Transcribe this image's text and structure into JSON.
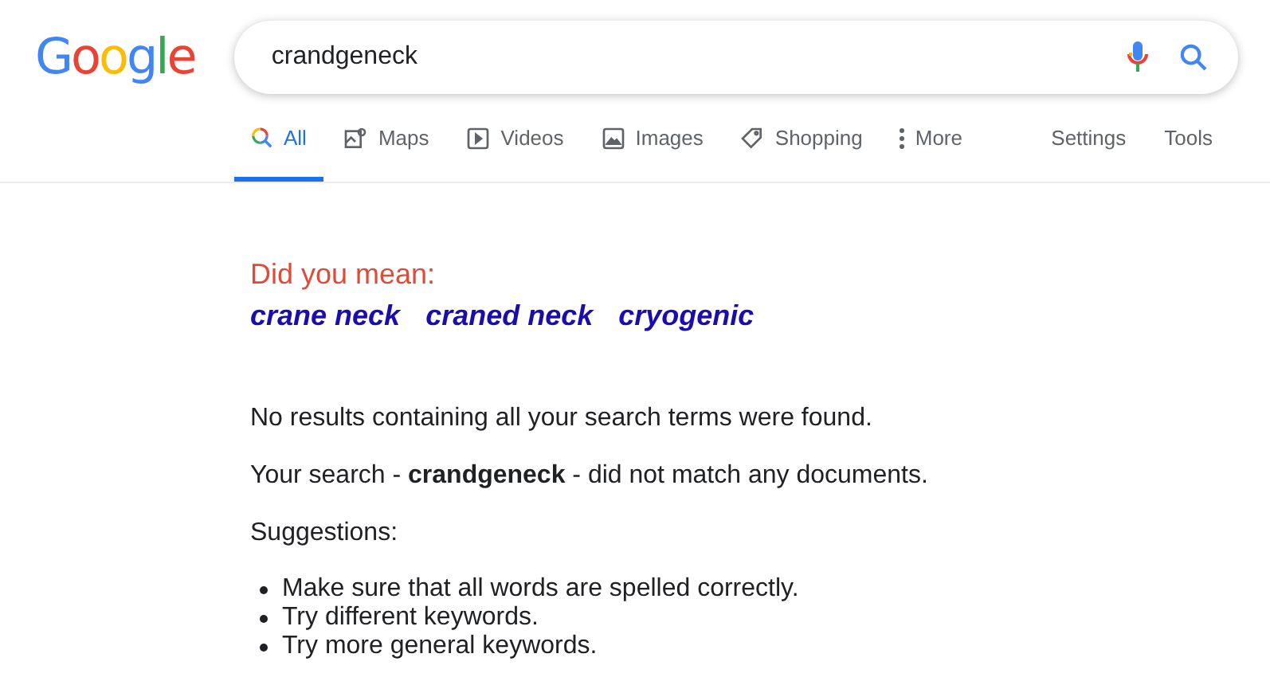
{
  "logo": [
    {
      "letter": "G",
      "color": "#4285f4"
    },
    {
      "letter": "o",
      "color": "#ea4335"
    },
    {
      "letter": "o",
      "color": "#fbbc05"
    },
    {
      "letter": "g",
      "color": "#4285f4"
    },
    {
      "letter": "l",
      "color": "#34a853"
    },
    {
      "letter": "e",
      "color": "#ea4335"
    }
  ],
  "search": {
    "value": "crandgeneck"
  },
  "tabs": [
    {
      "label": "All",
      "kind": "search",
      "selected": true
    },
    {
      "label": "Maps",
      "kind": "map",
      "selected": false
    },
    {
      "label": "Videos",
      "kind": "play",
      "selected": false
    },
    {
      "label": "Images",
      "kind": "image",
      "selected": false
    },
    {
      "label": "Shopping",
      "kind": "tag",
      "selected": false
    },
    {
      "label": "More",
      "kind": "dots",
      "selected": false
    }
  ],
  "tools": [
    "Settings",
    "Tools"
  ],
  "did_you_mean": {
    "heading": "Did you mean:",
    "suggestions": [
      "crane neck",
      "craned neck",
      "cryogenic"
    ]
  },
  "message": "No results containing all your search terms were found.",
  "detail": "Your search - **crandgeneck** - did not match any documents.",
  "suggestions_heading": "Suggestions:",
  "tips": [
    "Make sure that all words are spelled correctly.",
    "Try different keywords.",
    "Try more general keywords."
  ]
}
